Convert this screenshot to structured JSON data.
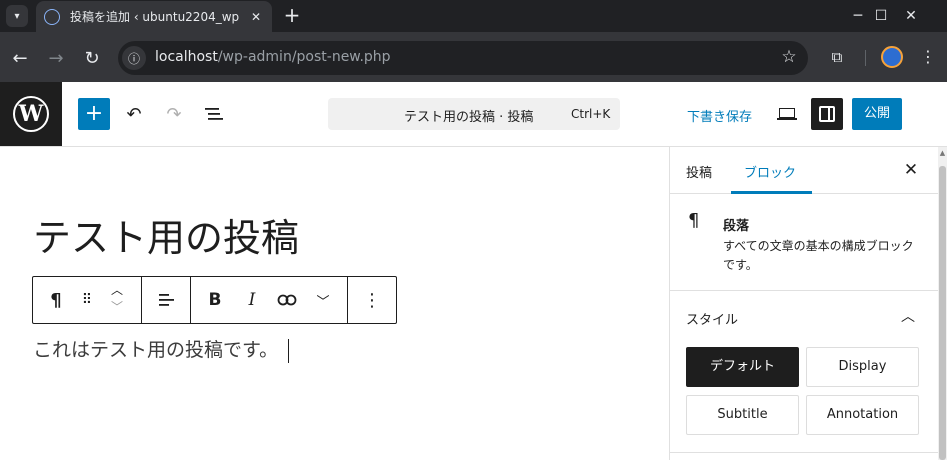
{
  "browser": {
    "tab_title": "投稿を追加 ‹ ubuntu2204_wp —",
    "url_host": "localhost",
    "url_path": "/wp-admin/post-new.php",
    "icons": [
      "tab-list-icon",
      "favicon-icon",
      "close-icon",
      "plus-icon",
      "minimize-icon",
      "maximize-icon",
      "close-window-icon",
      "back-icon",
      "forward-icon",
      "reload-icon",
      "site-info-icon",
      "bookmark-star-icon",
      "extensions-icon",
      "profile-icon",
      "kebab-menu-icon"
    ]
  },
  "header": {
    "doc_title": "テスト用の投稿 · 投稿",
    "shortcut": "Ctrl+K",
    "save_draft": "下書き保存",
    "publish": "公開",
    "icons": [
      "wordpress-logo-icon",
      "plus-icon",
      "undo-icon",
      "redo-icon",
      "document-overview-icon",
      "preview-icon",
      "settings-sidebar-icon"
    ]
  },
  "editor": {
    "post_title": "テスト用の投稿",
    "paragraph": "これはテスト用の投稿です。",
    "block_toolbar_icons": [
      "paragraph-icon",
      "drag-handle-icon",
      "move-up-icon",
      "move-down-icon",
      "align-icon",
      "bold-icon",
      "italic-icon",
      "link-icon",
      "more-chevron-icon",
      "options-icon"
    ]
  },
  "sidebar": {
    "tabs": [
      {
        "label": "投稿",
        "active": false
      },
      {
        "label": "ブロック",
        "active": true
      }
    ],
    "block": {
      "name": "段落",
      "description": "すべての文章の基本の構成ブロックです。"
    },
    "styles_title": "スタイル",
    "styles": [
      "デフォルト",
      "Display",
      "Subtitle",
      "Annotation"
    ]
  },
  "colors": {
    "accent": "#007cba",
    "dark": "#1e1e1e",
    "chrome_dark": "#202124",
    "chrome_toolbar": "#35363a"
  }
}
